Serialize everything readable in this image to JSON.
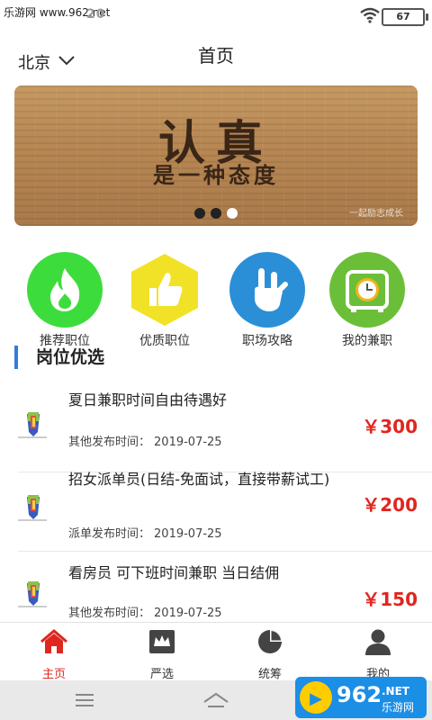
{
  "status_bar": {
    "watermark": "乐游网 www.962.net",
    "time": "20",
    "battery": "67"
  },
  "header": {
    "city": "北京",
    "title": "首页"
  },
  "banner": {
    "main_text": "认真",
    "sub_text": "是一种态度",
    "credit": "一起励志成长"
  },
  "categories": [
    {
      "label": "推荐职位",
      "icon": "flame-icon",
      "color": "#3ddc3d"
    },
    {
      "label": "优质职位",
      "icon": "thumbs-up-icon",
      "color": "#f2e227"
    },
    {
      "label": "职场攻略",
      "icon": "rock-hand-icon",
      "color": "#2b8fd8"
    },
    {
      "label": "我的兼职",
      "icon": "clock-icon",
      "color": "#6bbf38"
    }
  ],
  "section": {
    "title": "岗位优选"
  },
  "jobs": [
    {
      "title": "夏日兼职时间自由待遇好",
      "category": "其他",
      "posted_label": "发布时间：",
      "date": "2019-07-25",
      "price": "￥300"
    },
    {
      "title": "招女派单员(日结-免面试，直接带薪试工)",
      "category": "派单",
      "posted_label": "发布时间：",
      "date": "2019-07-25",
      "price": "￥200"
    },
    {
      "title": "看房员 可下班时间兼职 当日结佣",
      "category": "其他",
      "posted_label": "发布时间：",
      "date": "2019-07-25",
      "price": "￥150"
    }
  ],
  "tabs": [
    {
      "label": "主页",
      "icon": "home-icon",
      "active": true
    },
    {
      "label": "严选",
      "icon": "crown-icon",
      "active": false
    },
    {
      "label": "统筹",
      "icon": "pie-chart-icon",
      "active": false
    },
    {
      "label": "我的",
      "icon": "user-icon",
      "active": false
    }
  ],
  "watermark_badge": {
    "brand": "962",
    "suffix": ".NET",
    "name": "乐游网"
  },
  "colors": {
    "accent": "#e0261f",
    "section_bar": "#2f7fd8"
  }
}
